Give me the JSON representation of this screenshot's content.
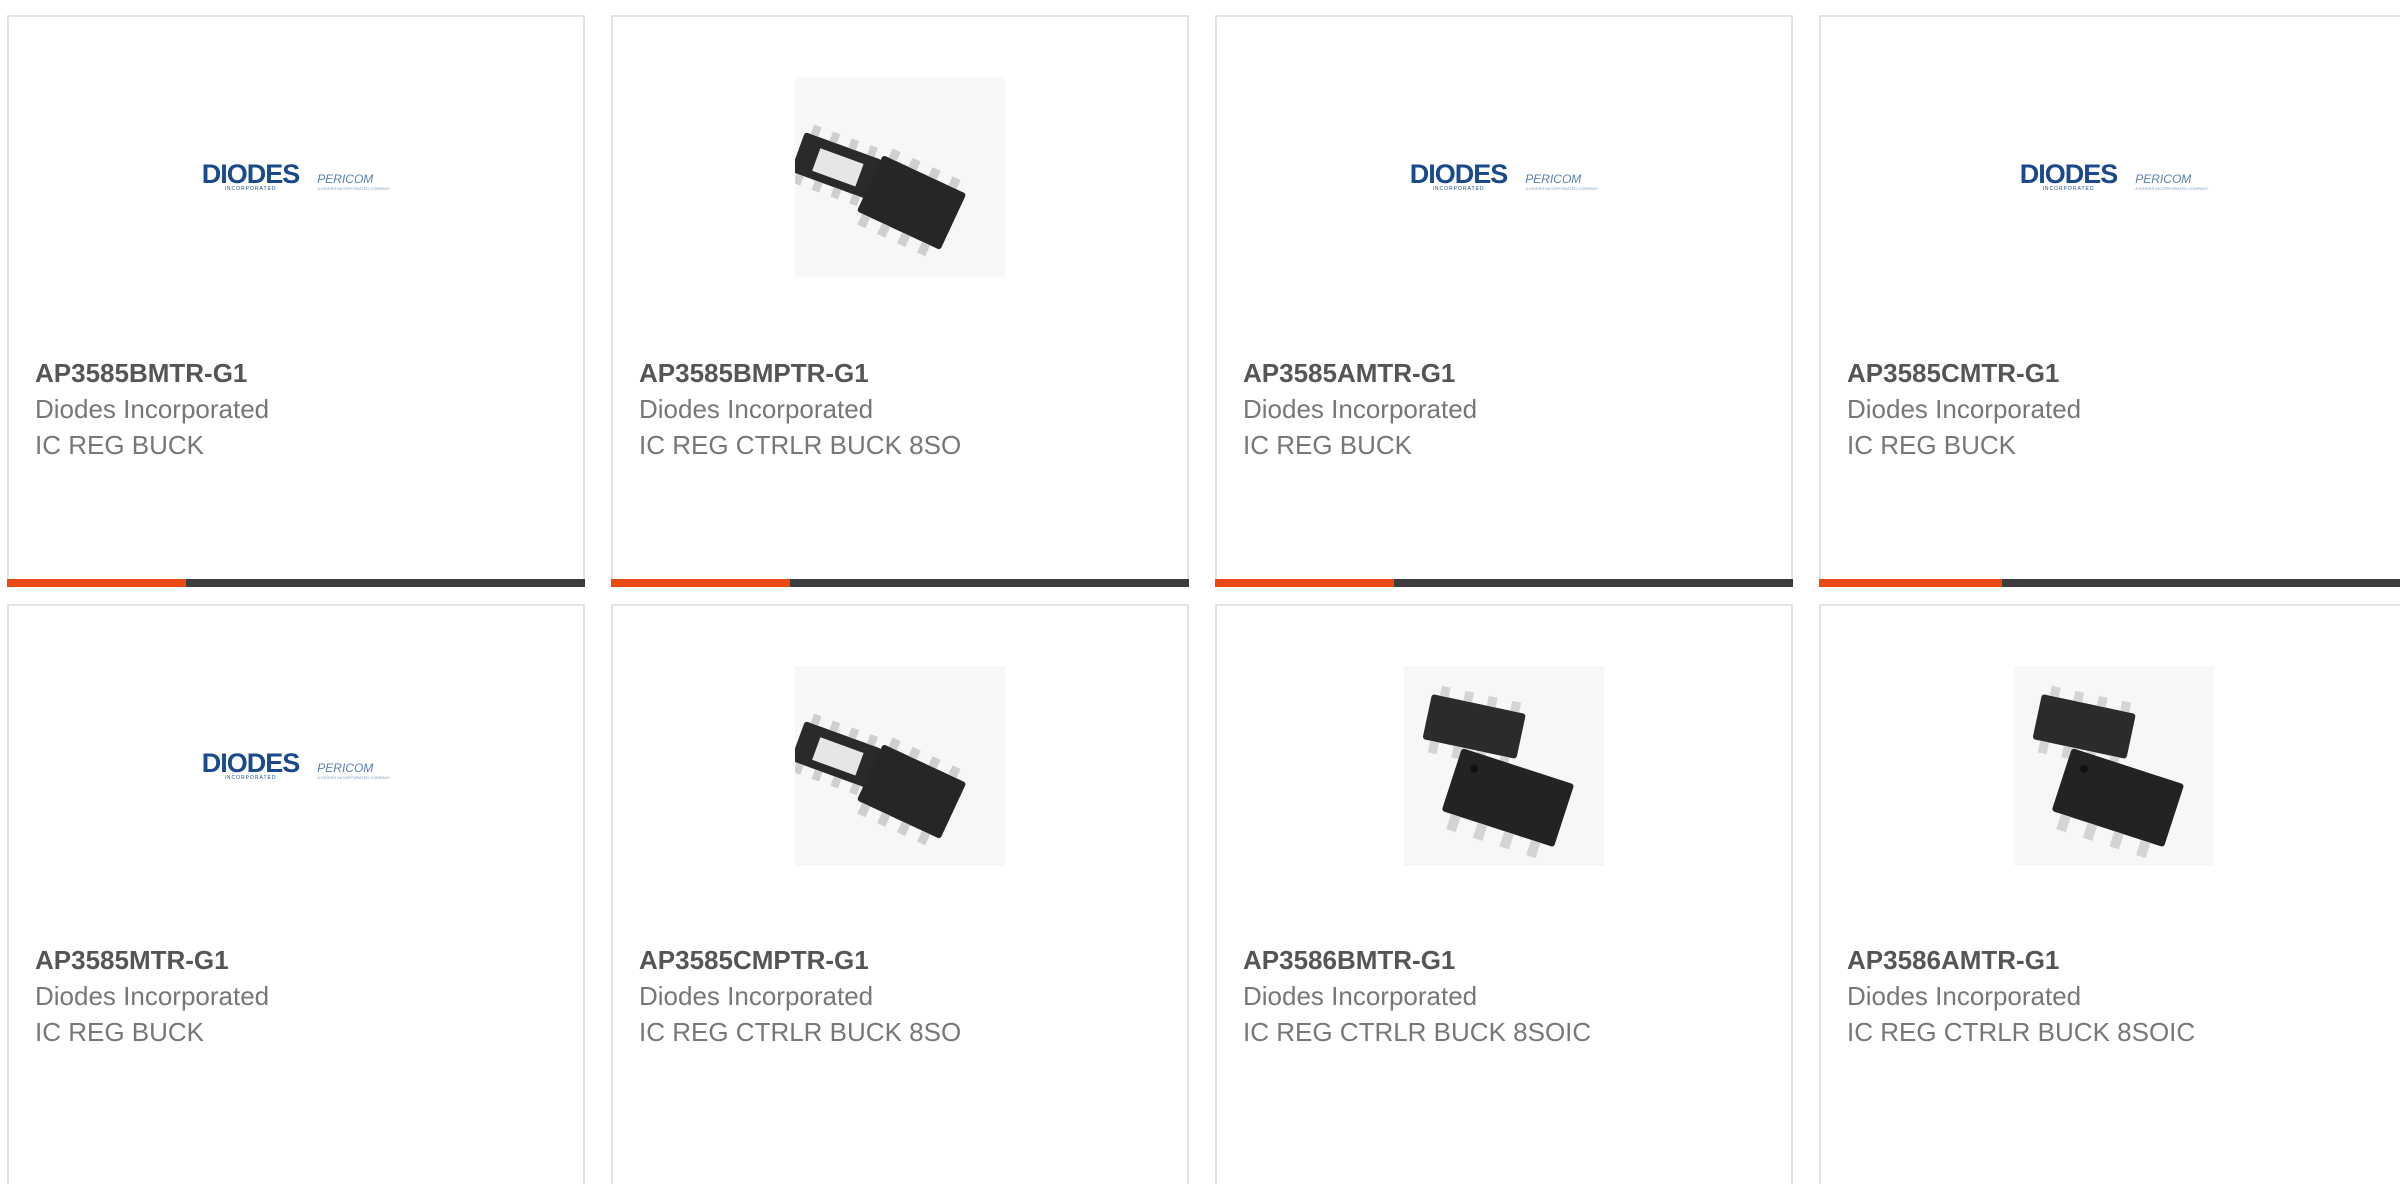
{
  "colors": {
    "accent": "#e84a10",
    "bar_track": "#3d3d3d",
    "logo_blue": "#1b4a8c"
  },
  "products": [
    {
      "part_number": "AP3585BMTR-G1",
      "manufacturer": "Diodes Incorporated",
      "description": "IC REG BUCK",
      "image": "diodes-logo",
      "progress": 0.31
    },
    {
      "part_number": "AP3585BMPTR-G1",
      "manufacturer": "Diodes Incorporated",
      "description": "IC REG CTRLR BUCK 8SO",
      "image": "soic-8-chip-pair",
      "progress": 0.31
    },
    {
      "part_number": "AP3585AMTR-G1",
      "manufacturer": "Diodes Incorporated",
      "description": "IC REG BUCK",
      "image": "diodes-logo",
      "progress": 0.31
    },
    {
      "part_number": "AP3585CMTR-G1",
      "manufacturer": "Diodes Incorporated",
      "description": "IC REG BUCK",
      "image": "diodes-logo",
      "progress": 0.31
    },
    {
      "part_number": "AP3585MTR-G1",
      "manufacturer": "Diodes Incorporated",
      "description": "IC REG BUCK",
      "image": "diodes-logo"
    },
    {
      "part_number": "AP3585CMPTR-G1",
      "manufacturer": "Diodes Incorporated",
      "description": "IC REG CTRLR BUCK 8SO",
      "image": "soic-8-chip-pair"
    },
    {
      "part_number": "AP3586BMTR-G1",
      "manufacturer": "Diodes Incorporated",
      "description": "IC REG CTRLR BUCK 8SOIC",
      "image": "soic-8-chip-pair-large"
    },
    {
      "part_number": "AP3586AMTR-G1",
      "manufacturer": "Diodes Incorporated",
      "description": "IC REG CTRLR BUCK 8SOIC",
      "image": "soic-8-chip-pair-large"
    }
  ],
  "logo": {
    "main": "DIODES",
    "main_sub": "INCORPORATED",
    "side": "PERICOM",
    "side_tag": "A DIODES INCORPORATED COMPANY"
  }
}
